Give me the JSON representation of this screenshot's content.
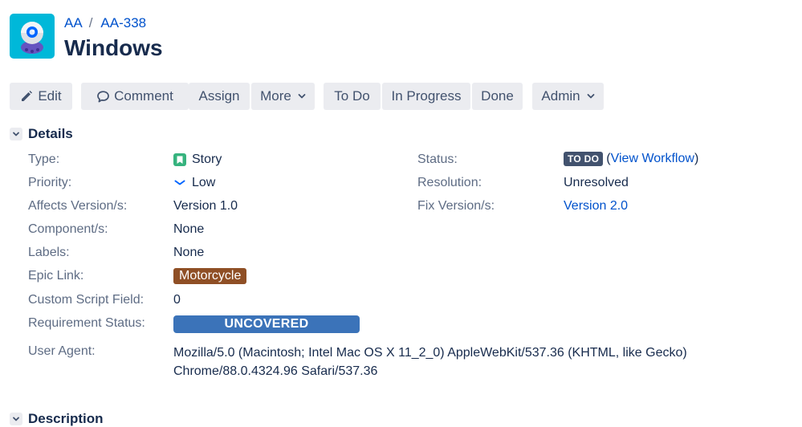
{
  "breadcrumb": {
    "project": "AA",
    "separator": "/",
    "issue_key": "AA-338"
  },
  "issue": {
    "title": "Windows"
  },
  "toolbar": {
    "edit": "Edit",
    "comment": "Comment",
    "assign": "Assign",
    "more": "More",
    "todo": "To Do",
    "in_progress": "In Progress",
    "done": "Done",
    "admin": "Admin"
  },
  "details": {
    "header": "Details",
    "type_label": "Type:",
    "type_value": "Story",
    "priority_label": "Priority:",
    "priority_value": "Low",
    "affects_label": "Affects Version/s:",
    "affects_value": "Version 1.0",
    "components_label": "Component/s:",
    "components_value": "None",
    "labels_label": "Labels:",
    "labels_value": "None",
    "epic_label": "Epic Link:",
    "epic_value": "Motorcycle",
    "custom_label": "Custom Script Field:",
    "custom_value": "0",
    "req_label": "Requirement Status:",
    "req_value": "UNCOVERED",
    "ua_label": "User Agent:",
    "ua_line1": "Mozilla/5.0 (Macintosh; Intel Mac OS X 11_2_0) AppleWebKit/537.36 (KHTML, like Gecko)",
    "ua_line2": "Chrome/88.0.4324.96 Safari/537.36",
    "status_label": "Status:",
    "status_value": "TO DO",
    "workflow_open": "(",
    "workflow_link": "View Workflow",
    "workflow_close": ")",
    "resolution_label": "Resolution:",
    "resolution_value": "Unresolved",
    "fix_label": "Fix Version/s:",
    "fix_value": "Version 2.0"
  },
  "description": {
    "header": "Description"
  },
  "icons": {
    "project_avatar": "ufo-avatar-icon",
    "edit": "pencil-icon",
    "comment": "comment-bubble-icon",
    "dropdown": "chevron-down-icon",
    "section_toggle": "chevron-down-icon",
    "type": "story-bookmark-icon",
    "priority": "priority-low-icon"
  },
  "colors": {
    "link": "#0052cc",
    "button_bg": "#ebecf0",
    "story": "#36b37e",
    "status_lozenge": "#42526e",
    "epic": "#8f4f25",
    "requirement": "#3b73b9",
    "avatar_bg": "#00b8d9"
  }
}
